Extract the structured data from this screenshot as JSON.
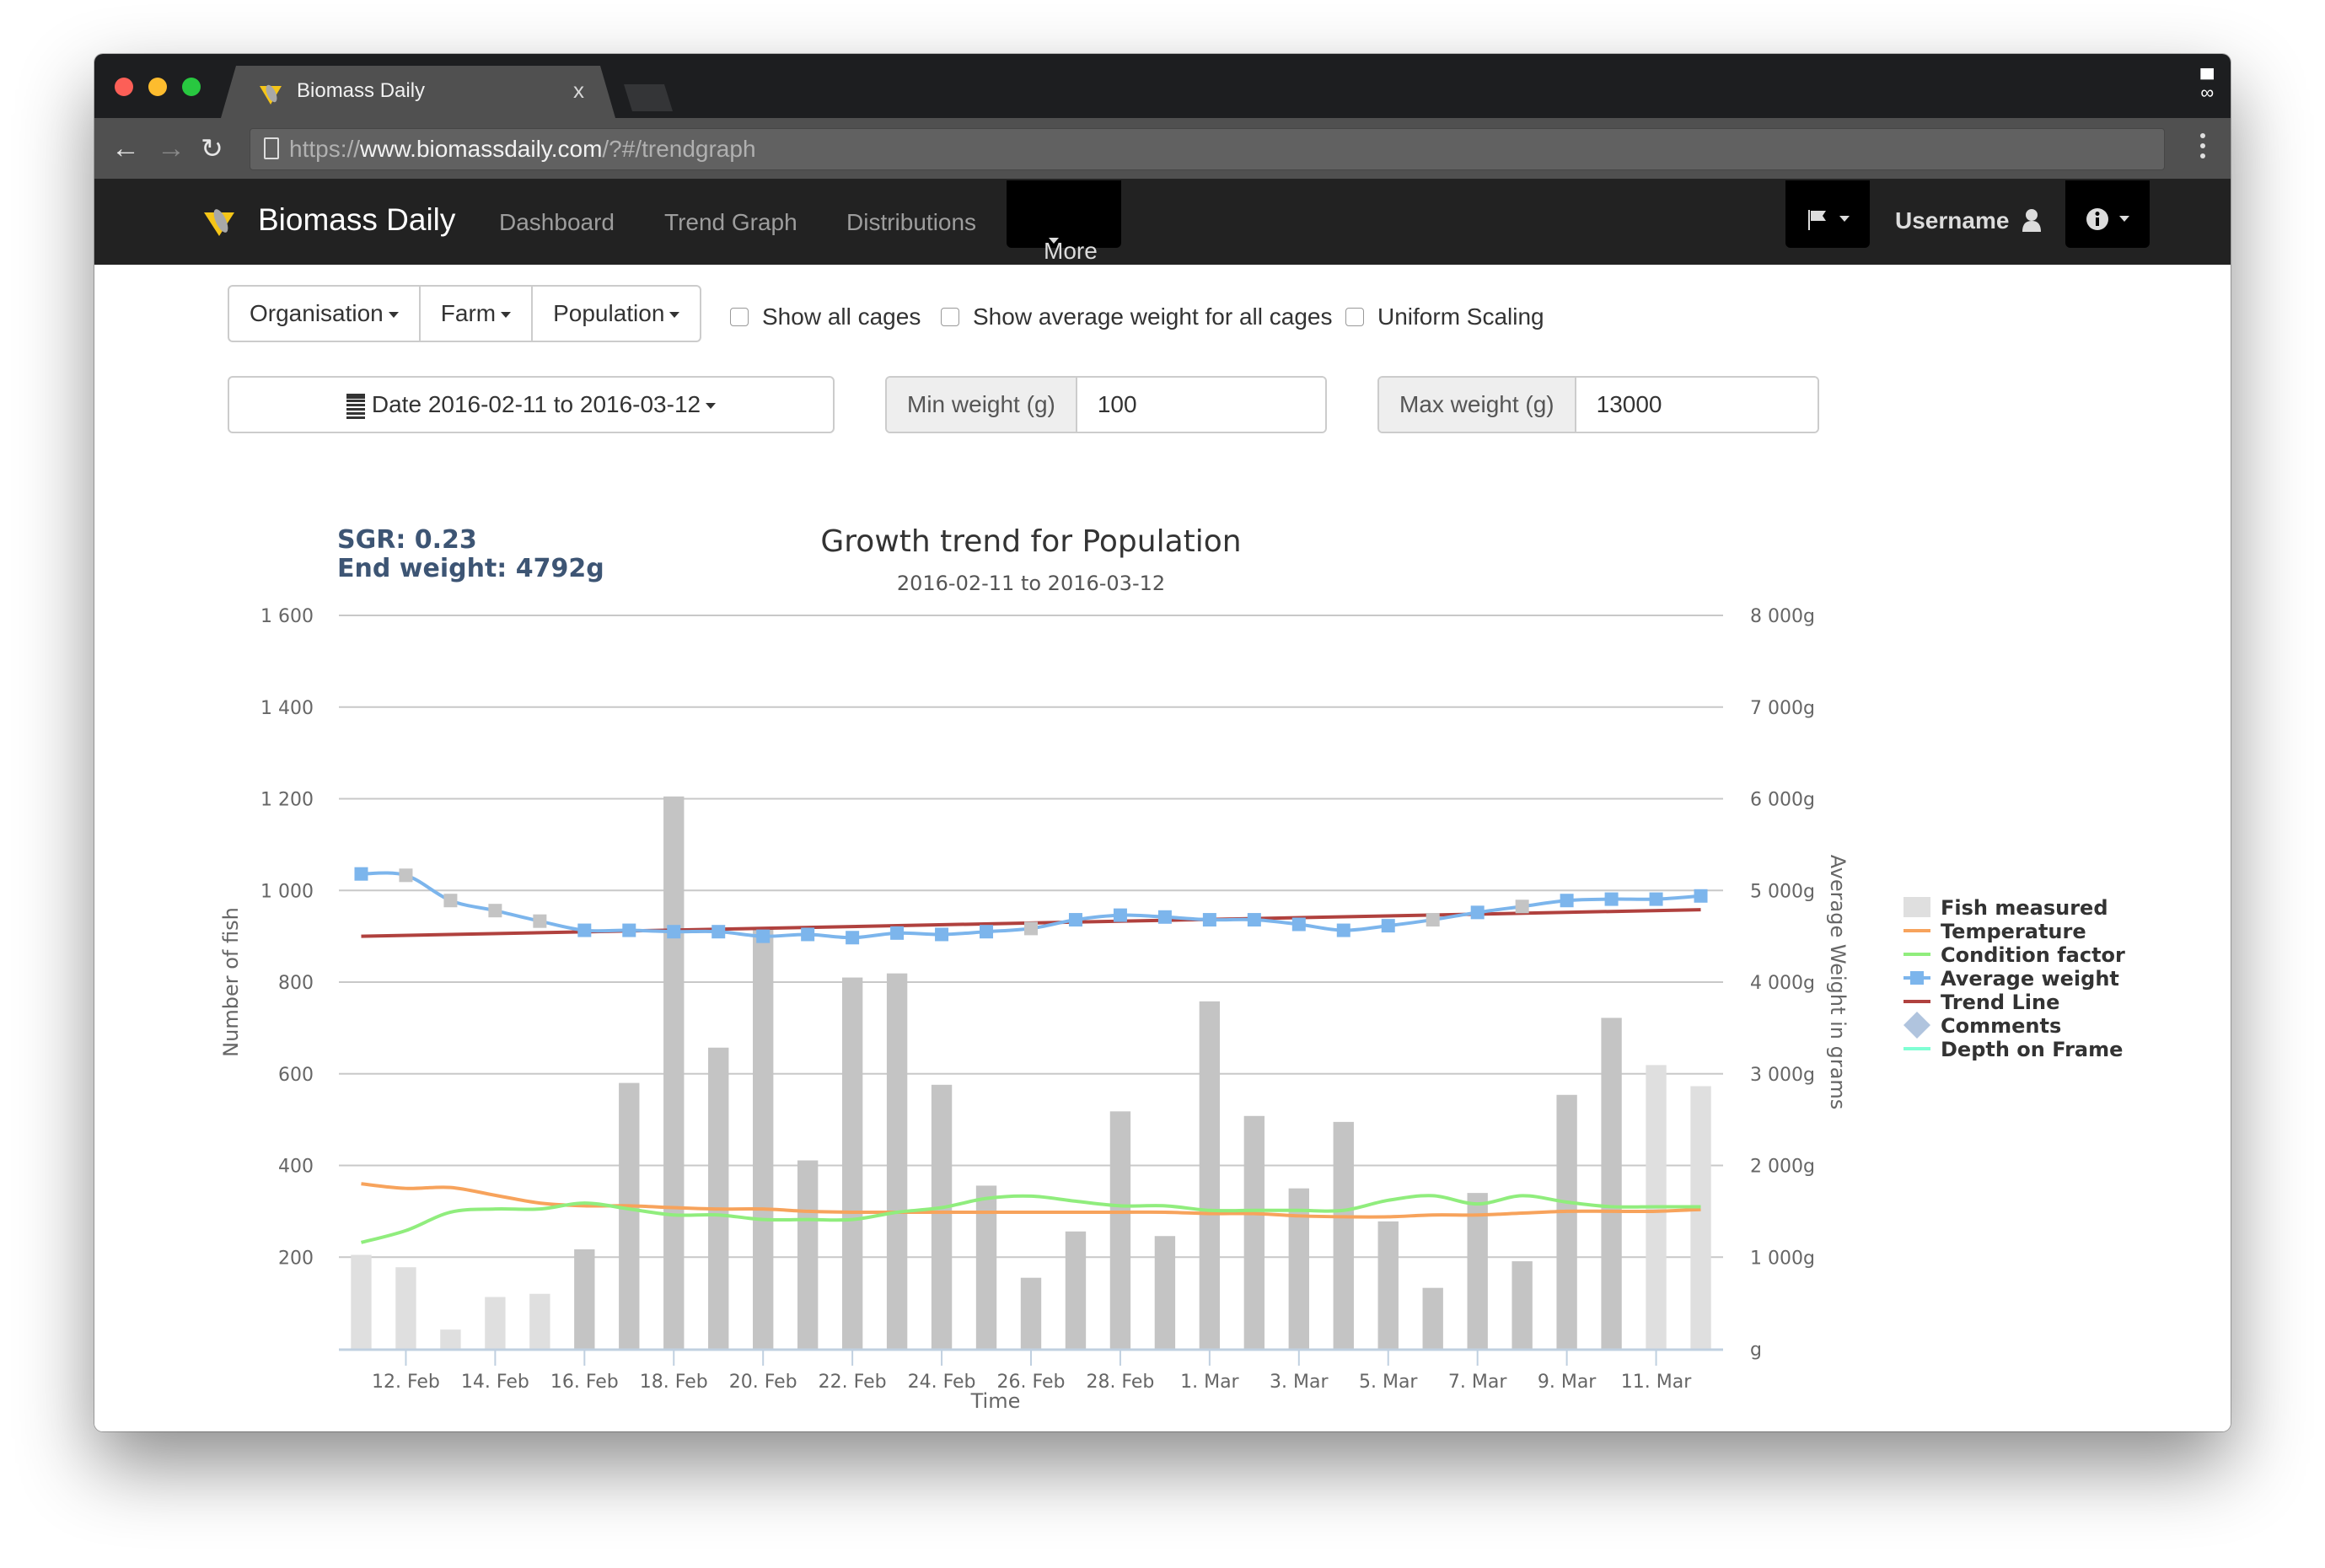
{
  "browser": {
    "tab_title": "Biomass Daily",
    "tab_close": "x",
    "url_scheme": "https://",
    "url_host": "www.biomassdaily.com",
    "url_path": "/?#/trendgraph"
  },
  "navbar": {
    "brand": "Biomass Daily",
    "links": [
      "Dashboard",
      "Trend Graph",
      "Distributions"
    ],
    "more": "More",
    "username": "Username"
  },
  "filters": {
    "organisation": "Organisation",
    "farm": "Farm",
    "population": "Population",
    "show_all_cages": "Show all cages",
    "show_avg_weight_all": "Show average weight for all cages",
    "uniform_scaling": "Uniform Scaling",
    "checkbox_states": {
      "show_all_cages": false,
      "show_avg_weight_all": false,
      "uniform_scaling": false
    },
    "date_range": "Date 2016-02-11 to 2016-03-12",
    "min_weight_label": "Min weight (g)",
    "min_weight_value": "100",
    "max_weight_label": "Max weight (g)",
    "max_weight_value": "13000"
  },
  "stats": {
    "sgr": "SGR: 0.23",
    "end_weight": "End weight: 4792g"
  },
  "chart_data": {
    "type": "bar",
    "title": "Growth trend for Population",
    "subtitle": "2016-02-11 to 2016-03-12",
    "xlabel": "Time",
    "ylabel": "Number of fish",
    "y2label": "Average Weight in grams",
    "ylim": [
      0,
      1600
    ],
    "y2lim": [
      0,
      8000
    ],
    "yticks": [
      "",
      "200",
      "400",
      "600",
      "800",
      "1 000",
      "1 200",
      "1 400",
      "1 600"
    ],
    "y2ticks": [
      "g",
      "1 000g",
      "2 000g",
      "3 000g",
      "4 000g",
      "5 000g",
      "6 000g",
      "7 000g",
      "8 000g"
    ],
    "xtick_labels": [
      "12. Feb",
      "14. Feb",
      "16. Feb",
      "18. Feb",
      "20. Feb",
      "22. Feb",
      "24. Feb",
      "26. Feb",
      "28. Feb",
      "1. Mar",
      "3. Mar",
      "5. Mar",
      "7. Mar",
      "9. Mar",
      "11. Mar"
    ],
    "xtick_indices": [
      1,
      3,
      5,
      7,
      9,
      11,
      13,
      15,
      17,
      19,
      21,
      23,
      25,
      27,
      29
    ],
    "categories": [
      "2016-02-11",
      "2016-02-12",
      "2016-02-13",
      "2016-02-14",
      "2016-02-15",
      "2016-02-16",
      "2016-02-17",
      "2016-02-18",
      "2016-02-19",
      "2016-02-20",
      "2016-02-21",
      "2016-02-22",
      "2016-02-23",
      "2016-02-24",
      "2016-02-25",
      "2016-02-26",
      "2016-02-27",
      "2016-02-28",
      "2016-02-29",
      "2016-03-01",
      "2016-03-02",
      "2016-03-03",
      "2016-03-04",
      "2016-03-05",
      "2016-03-06",
      "2016-03-07",
      "2016-03-08",
      "2016-03-09",
      "2016-03-10",
      "2016-03-11",
      "2016-03-12"
    ],
    "grid": true,
    "legend_position": "right",
    "series": [
      {
        "name": "Fish measured",
        "type": "bar",
        "axis": "left",
        "color": "#c4c4c4",
        "muted_color": "#dfdfdf",
        "values": [
          205,
          178,
          42,
          113,
          120,
          217,
          580,
          1205,
          657,
          916,
          411,
          810,
          819,
          576,
          356,
          155,
          256,
          518,
          246,
          758,
          508,
          350,
          495,
          278,
          133,
          340,
          191,
          554,
          722,
          619,
          573
        ],
        "muted": [
          true,
          true,
          true,
          true,
          true,
          false,
          false,
          false,
          false,
          false,
          false,
          false,
          false,
          false,
          false,
          false,
          false,
          false,
          false,
          false,
          false,
          false,
          false,
          false,
          false,
          false,
          false,
          false,
          false,
          true,
          true
        ]
      },
      {
        "name": "Temperature",
        "type": "line",
        "axis": "left",
        "color": "#f7a35c",
        "values": [
          360,
          350,
          352,
          335,
          318,
          312,
          312,
          308,
          305,
          305,
          300,
          298,
          298,
          298,
          298,
          298,
          298,
          298,
          298,
          295,
          295,
          290,
          288,
          288,
          292,
          292,
          296,
          300,
          300,
          300,
          304
        ]
      },
      {
        "name": "Condition factor",
        "type": "line",
        "axis": "left",
        "color": "#90ed7d",
        "values": [
          232,
          258,
          298,
          305,
          305,
          318,
          305,
          292,
          292,
          282,
          282,
          282,
          298,
          308,
          328,
          333,
          322,
          312,
          312,
          302,
          302,
          302,
          302,
          324,
          334,
          316,
          334,
          320,
          310,
          310,
          310
        ]
      },
      {
        "name": "Average weight",
        "type": "line",
        "axis": "right",
        "color": "#7cb5ec",
        "marker": "square",
        "values": [
          5180,
          5165,
          4890,
          4780,
          4665,
          4565,
          4565,
          4550,
          4550,
          4500,
          4520,
          4485,
          4535,
          4520,
          4550,
          4585,
          4680,
          4730,
          4710,
          4680,
          4680,
          4630,
          4565,
          4615,
          4680,
          4760,
          4825,
          4890,
          4905,
          4905,
          4940
        ],
        "grey_markers": [
          false,
          true,
          true,
          true,
          true,
          false,
          false,
          false,
          false,
          false,
          false,
          false,
          false,
          false,
          false,
          true,
          false,
          false,
          false,
          false,
          false,
          false,
          false,
          false,
          true,
          false,
          true,
          false,
          false,
          false,
          false
        ]
      },
      {
        "name": "Trend Line",
        "type": "line",
        "axis": "right",
        "color": "#b0413e",
        "values": [
          4500,
          4790
        ],
        "x_indices": [
          0,
          30
        ]
      },
      {
        "name": "Comments",
        "type": "scatter",
        "axis": "right",
        "color": "#b0c4de",
        "marker": "diamond",
        "values": []
      },
      {
        "name": "Depth on Frame",
        "type": "line",
        "axis": "left",
        "color": "#7fffd4",
        "values": []
      }
    ]
  }
}
